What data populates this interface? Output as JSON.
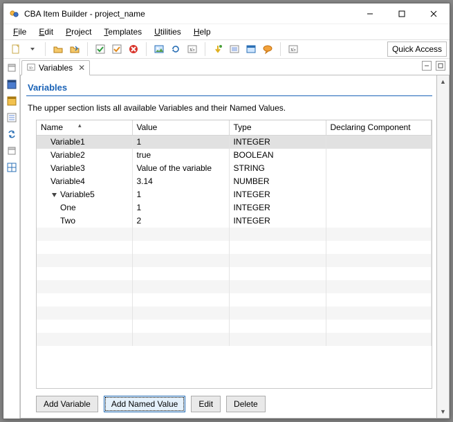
{
  "window": {
    "title": "CBA Item Builder - project_name"
  },
  "menu": {
    "file": "File",
    "edit": "Edit",
    "project": "Project",
    "templates": "Templates",
    "utilities": "Utilities",
    "help": "Help"
  },
  "toolbar": {
    "quick_access": "Quick Access"
  },
  "tab": {
    "label": "Variables"
  },
  "section": {
    "title": "Variables",
    "description": "The upper section lists all available Variables and their Named Values."
  },
  "columns": {
    "name": "Name",
    "value": "Value",
    "type": "Type",
    "declaring": "Declaring Component"
  },
  "rows": [
    {
      "indent": 1,
      "expander": "",
      "name": "Variable1",
      "value": "1",
      "type": "INTEGER",
      "declaring": "",
      "selected": true
    },
    {
      "indent": 1,
      "expander": "",
      "name": "Variable2",
      "value": "true",
      "type": "BOOLEAN",
      "declaring": "",
      "selected": false
    },
    {
      "indent": 1,
      "expander": "",
      "name": "Variable3",
      "value": "Value of the variable",
      "type": "STRING",
      "declaring": "",
      "selected": false
    },
    {
      "indent": 1,
      "expander": "",
      "name": "Variable4",
      "value": "3.14",
      "type": "NUMBER",
      "declaring": "",
      "selected": false
    },
    {
      "indent": 1,
      "expander": "v",
      "name": "Variable5",
      "value": "1",
      "type": "INTEGER",
      "declaring": "",
      "selected": false
    },
    {
      "indent": 2,
      "expander": "",
      "name": "One",
      "value": "1",
      "type": "INTEGER",
      "declaring": "",
      "selected": false
    },
    {
      "indent": 2,
      "expander": "",
      "name": "Two",
      "value": "2",
      "type": "INTEGER",
      "declaring": "",
      "selected": false
    }
  ],
  "buttons": {
    "add_variable": "Add Variable",
    "add_named_value": "Add Named Value",
    "edit": "Edit",
    "delete": "Delete"
  }
}
